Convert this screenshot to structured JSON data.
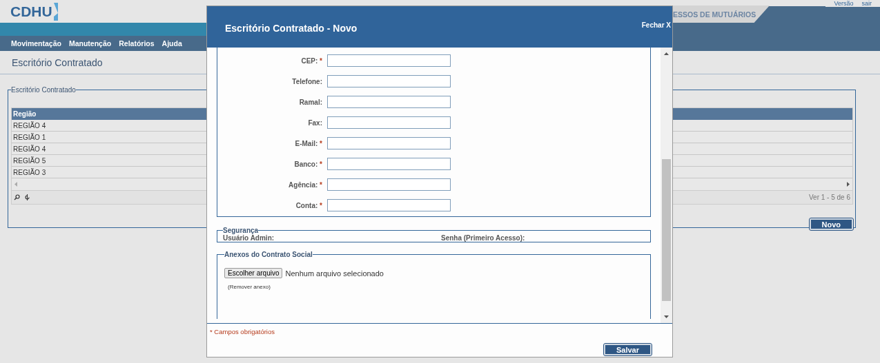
{
  "header": {
    "logo": "CDHU",
    "top_links": [
      "Versão",
      "sair"
    ],
    "banner": "ESSOS DE MUTUÁRIOS"
  },
  "menu": [
    "Movimentação",
    "Manutenção",
    "Relatórios",
    "Ajuda"
  ],
  "page_title": "Escritório Contratado",
  "grid": {
    "legend": "Escritório Contratado",
    "columns": [
      "Região"
    ],
    "rows": [
      [
        "REGIÃO 4"
      ],
      [
        "REGIÃO 1"
      ],
      [
        "REGIÃO 4"
      ],
      [
        "REGIÃO 5"
      ],
      [
        "REGIÃO 3"
      ]
    ],
    "pager": "Ver 1 - 5 de 6",
    "new_button": "Novo"
  },
  "dialog": {
    "title": "Escritório Contratado - Novo",
    "close": "Fechar X",
    "fields": [
      {
        "label": "CEP:",
        "required": true
      },
      {
        "label": "Telefone:",
        "required": false
      },
      {
        "label": "Ramal:",
        "required": false
      },
      {
        "label": "Fax:",
        "required": false
      },
      {
        "label": "E-Mail:",
        "required": true
      },
      {
        "label": "Banco:",
        "required": true
      },
      {
        "label": "Agência:",
        "required": true
      },
      {
        "label": "Conta:",
        "required": true
      }
    ],
    "security": {
      "legend": "Segurança",
      "user_label": "Usuário Admin:",
      "password_label": "Senha (Primeiro Acesso):"
    },
    "attachments": {
      "legend": "Anexos do Contrato Social",
      "file_button": "Escolher arquivo",
      "file_status": "Nenhum arquivo selecionado",
      "remove_link": "(Remover anexo)"
    },
    "required_mark": "*",
    "required_note": "* Campos obrigatórios",
    "save": "Salvar"
  }
}
